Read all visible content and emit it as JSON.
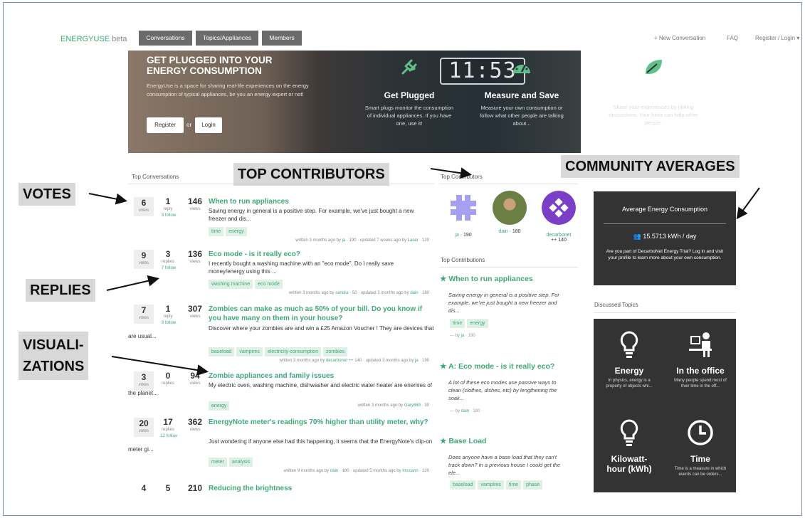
{
  "nav": {
    "brand": "ENERGYUSE",
    "brand_suffix": "beta",
    "tabs": [
      "Conversations",
      "Topics/Appliances",
      "Members"
    ],
    "new_conversation": "+ New Conversation",
    "faq": "FAQ",
    "register_login": "Register / Login"
  },
  "hero": {
    "title": "GET PLUGGED INTO YOUR ENERGY CONSUMPTION",
    "description": "EnergyUse is a space for sharing real-life experiences on the energy consumption of typical appliances, be you an energy expert or not!",
    "register": "Register",
    "or": "or",
    "login": "Login",
    "clock": "11:53",
    "features": [
      {
        "title": "Get Plugged",
        "desc": "Smart plugs monitor the consumption of individual appliances. If you have one, use it!",
        "icon": "plug-icon"
      },
      {
        "title": "Measure and Save",
        "desc": "Measure your own consumption or follow what other people are talking about...",
        "icon": "gauge-icon"
      },
      {
        "title": "Let's Save Together!",
        "desc": "Share your experiences by joining discussions. Your hints can help other people.",
        "icon": "leaf-icon"
      }
    ]
  },
  "sections": {
    "top_conversations": "Top Conversations",
    "top_contributors": "Top Contributors",
    "top_contributions": "Top Contributions",
    "discussed_topics": "Discussed Topics"
  },
  "conversations": [
    {
      "votes": "6",
      "votes_label": "votes",
      "replies": "1",
      "replies_label": "reply",
      "views": "146",
      "views_label": "views",
      "follow": "3 follow",
      "title": "When to run appliances",
      "excerpt": "Saving energy in general is a positive step. For example, we've just bought a new freezer and dis...",
      "tags": [
        "time",
        "energy"
      ],
      "meta_pre": "written 3 months ago by ",
      "meta_author": "ja",
      "meta_mid": " · 190 · updated 7 weeks ago by ",
      "meta_updater": "Laser",
      "meta_post": " · 120"
    },
    {
      "votes": "9",
      "votes_label": "votes",
      "replies": "3",
      "replies_label": "replies",
      "views": "136",
      "views_label": "views",
      "follow": "7 follow",
      "title": "Eco mode - is it really eco?",
      "excerpt": "I recently bought a washing machine with an \"eco mode\". Do I really save money/energy using this ...",
      "tags": [
        "washing machine",
        "eco mode"
      ],
      "meta_pre": "written 3 months ago by ",
      "meta_author": "sandra",
      "meta_mid": " · 50 · updated 3 months ago by ",
      "meta_updater": "dain",
      "meta_post": " · 180"
    },
    {
      "votes": "7",
      "votes_label": "votes",
      "replies": "1",
      "replies_label": "reply",
      "views": "307",
      "views_label": "views",
      "follow": "3 follow",
      "title": "Zombies can make as much as 50% of your bill. Do you know if you have many on them in your house?",
      "excerpt": "Discover where your zombies are and win a £25 Amazon Voucher ! They are devices that are usual...",
      "tags": [
        "baseload",
        "vampires",
        "electricity-consumption",
        "zombies"
      ],
      "meta_pre": "written 3 months ago by ",
      "meta_author": "decarbonet",
      "meta_mid": " ++ 140 · updated 3 months ago by ",
      "meta_updater": "ja",
      "meta_post": " · 190"
    },
    {
      "votes": "3",
      "votes_label": "votes",
      "replies": "0",
      "replies_label": "replies",
      "views": "94",
      "views_label": "views",
      "follow": "",
      "title": "Zombie appliances and family issues",
      "excerpt": "My electric oven, washing machine, dishwasher and electric water heater are enemies of the planet...",
      "tags": [
        "energy"
      ],
      "meta_pre": "written 3 months ago by ",
      "meta_author": "Gary869",
      "meta_mid": " · 30",
      "meta_updater": "",
      "meta_post": ""
    },
    {
      "votes": "20",
      "votes_label": "votes",
      "replies": "17",
      "replies_label": "replies",
      "views": "362",
      "views_label": "views",
      "follow": "12 follow",
      "title": "EnergyNote meter's readings 70% higher than utility meter, why?",
      "excerpt": "Just wondering if anyone else had this happening, it seems that the EnergyNote's clip-on meter gi...",
      "tags": [
        "meter",
        "analysis"
      ],
      "meta_pre": "written 9 months ago by ",
      "meta_author": "dain",
      "meta_mid": " · 180 · updated 5 months ago by ",
      "meta_updater": "lmccann",
      "meta_post": " · 120"
    },
    {
      "votes": "4",
      "votes_label": "",
      "replies": "5",
      "replies_label": "",
      "views": "210",
      "views_label": "",
      "follow": "",
      "title": "Reducing the brightness",
      "excerpt": "",
      "tags": [],
      "meta_pre": "",
      "meta_author": "",
      "meta_mid": "",
      "meta_updater": "",
      "meta_post": ""
    }
  ],
  "contributors": [
    {
      "name": "ja",
      "rep": " · 190",
      "extra": "",
      "color": "#9b8ff0"
    },
    {
      "name": "dain",
      "rep": " · 180",
      "extra": "",
      "color": "#5d7a3a"
    },
    {
      "name": "decarbonet",
      "rep": "",
      "extra": "++ 140",
      "color": "#7b3fc7"
    }
  ],
  "contributions": [
    {
      "title": "When to run appliances",
      "text": "Saving energy in general is a positive step. For example, we've just bought a new freezer and dis...",
      "tags": [
        "time",
        "energy"
      ],
      "by_pre": "— by ",
      "by_name": "ja",
      "by_rep": " · 190"
    },
    {
      "title": "A: Eco mode - is it really eco?",
      "text": "A lot of these eco modes use passive ways to clean (clothes, dishes, etc) by lengthening the soak...",
      "tags": [],
      "by_pre": "— by ",
      "by_name": "dain",
      "by_rep": " · 180"
    },
    {
      "title": "Base Load",
      "text": "Does anyone have a base load that they can't track down? In a previous house I could get the ele...",
      "tags": [
        "baseload",
        "vampires",
        "time",
        "phase"
      ],
      "by_pre": "",
      "by_name": "",
      "by_rep": ""
    }
  ],
  "community": {
    "title": "Average Energy Consumption",
    "value": "15.5713 kWh / day",
    "note": "Are you part of DecarboNet Energy Trial? Log in and visit your profile to learn more about your own consumption."
  },
  "topics": [
    {
      "name": "Energy",
      "desc": "In physics, energy is a property of objects whi...",
      "icon": "lightbulb-icon"
    },
    {
      "name": "In the office",
      "desc": "Many people spend most of their time in the off...",
      "icon": "office-worker-icon"
    },
    {
      "name": "Kilowatt-hour (kWh)",
      "desc": "",
      "icon": "lightbulb-icon"
    },
    {
      "name": "Time",
      "desc": "Time is a measure in which events can be orders...",
      "icon": "clock-icon"
    }
  ],
  "annotations": {
    "votes": "VOTES",
    "replies": "REPLIES",
    "visualizations": "VISUALI-\nZATIONS",
    "top_contributors": "TOP CONTRIBUTORS",
    "community_averages": "COMMUNITY AVERAGES"
  },
  "colors": {
    "accent": "#3fa878",
    "dark_panel": "#333333",
    "callout": "#d8d8d8"
  }
}
